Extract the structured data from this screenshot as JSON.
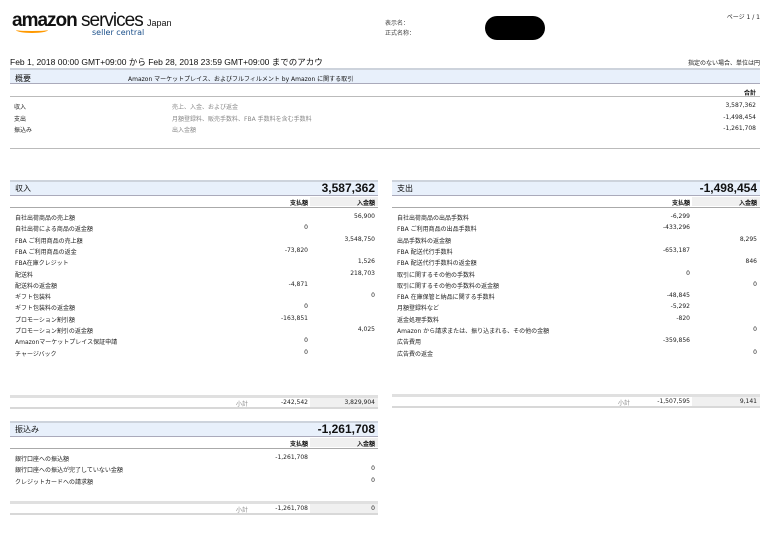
{
  "header": {
    "logo_main": "amazon",
    "logo_services": "services",
    "logo_japan": "Japan",
    "logo_sub": "seller central",
    "display_name_label": "表示名：",
    "legal_name_label": "正式名称：",
    "page": "ページ 1 / 1"
  },
  "period": "Feb 1, 2018 00:00 GMT+09:00 から Feb 28, 2018 23:59 GMT+09:00 までのアカウ",
  "unit_note": "指定のない場合、単位は円",
  "summary": {
    "title": "概要",
    "description": "Amazon マーケットプレイス、およびフルフィルメント by Amazon に関する取引",
    "total_header": "合計",
    "rows": [
      {
        "label": "収入",
        "desc": "売上、入金、および返金",
        "value": "3,587,362"
      },
      {
        "label": "支出",
        "desc": "月額登録料、販売手数料、FBA 手数料を含む手数料",
        "value": "-1,498,454"
      },
      {
        "label": "振込み",
        "desc": "出入金額",
        "value": "-1,261,708"
      }
    ]
  },
  "columns": {
    "debit": "支払額",
    "credit": "入金額",
    "subtotal": "小計"
  },
  "income": {
    "title": "収入",
    "total": "3,587,362",
    "rows": [
      {
        "label": "自社出荷商品の売上額",
        "debit": "",
        "credit": "56,900"
      },
      {
        "label": "自社出荷による商品の返金額",
        "debit": "0",
        "credit": ""
      },
      {
        "label": "FBA ご利用商品の売上額",
        "debit": "",
        "credit": "3,548,750"
      },
      {
        "label": "FBA ご利用商品の返金",
        "debit": "-73,820",
        "credit": ""
      },
      {
        "label": "FBA在庫クレジット",
        "debit": "",
        "credit": "1,526"
      },
      {
        "label": "配送料",
        "debit": "",
        "credit": "218,703"
      },
      {
        "label": "配送料の返金額",
        "debit": "-4,871",
        "credit": ""
      },
      {
        "label": "ギフト包装料",
        "debit": "",
        "credit": "0"
      },
      {
        "label": "ギフト包装料の返金額",
        "debit": "0",
        "credit": ""
      },
      {
        "label": "プロモーション割引額",
        "debit": "-163,851",
        "credit": ""
      },
      {
        "label": "プロモーション割引の返金額",
        "debit": "",
        "credit": "4,025"
      },
      {
        "label": "Amazonマーケットプレイス保証申請",
        "debit": "0",
        "credit": ""
      },
      {
        "label": "チャージバック",
        "debit": "0",
        "credit": ""
      }
    ],
    "subtotal_debit": "-242,542",
    "subtotal_credit": "3,829,904"
  },
  "expense": {
    "title": "支出",
    "total": "-1,498,454",
    "rows": [
      {
        "label": "自社出荷商品の出品手数料",
        "debit": "-6,299",
        "credit": ""
      },
      {
        "label": "FBA ご利用商品の出品手数料",
        "debit": "-433,296",
        "credit": ""
      },
      {
        "label": "出品手数料の返金額",
        "debit": "",
        "credit": "8,295"
      },
      {
        "label": "FBA 配送代行手数料",
        "debit": "-653,187",
        "credit": ""
      },
      {
        "label": "FBA 配送代行手数料の返金額",
        "debit": "",
        "credit": "846"
      },
      {
        "label": "取引に関するその他の手数料",
        "debit": "0",
        "credit": ""
      },
      {
        "label": "取引に関するその他の手数料の返金額",
        "debit": "",
        "credit": "0"
      },
      {
        "label": "FBA 在庫保管と納品に関する手数料",
        "debit": "-48,845",
        "credit": ""
      },
      {
        "label": "月額登録料など",
        "debit": "-5,292",
        "credit": ""
      },
      {
        "label": "返金処理手数料",
        "debit": "-820",
        "credit": ""
      },
      {
        "label": "Amazon から請求または、振り込まれる、その他の金額",
        "debit": "",
        "credit": "0"
      },
      {
        "label": "広告費用",
        "debit": "-359,856",
        "credit": ""
      },
      {
        "label": "広告費の返金",
        "debit": "",
        "credit": "0"
      }
    ],
    "subtotal_debit": "-1,507,595",
    "subtotal_credit": "9,141"
  },
  "transfer": {
    "title": "振込み",
    "total": "-1,261,708",
    "rows": [
      {
        "label": "銀行口座への振込額",
        "debit": "-1,261,708",
        "credit": ""
      },
      {
        "label": "銀行口座への振込が完了していない金額",
        "debit": "",
        "credit": "0"
      },
      {
        "label": "クレジットカードへの請求額",
        "debit": "",
        "credit": "0"
      }
    ],
    "subtotal_debit": "-1,261,708",
    "subtotal_credit": "0"
  }
}
